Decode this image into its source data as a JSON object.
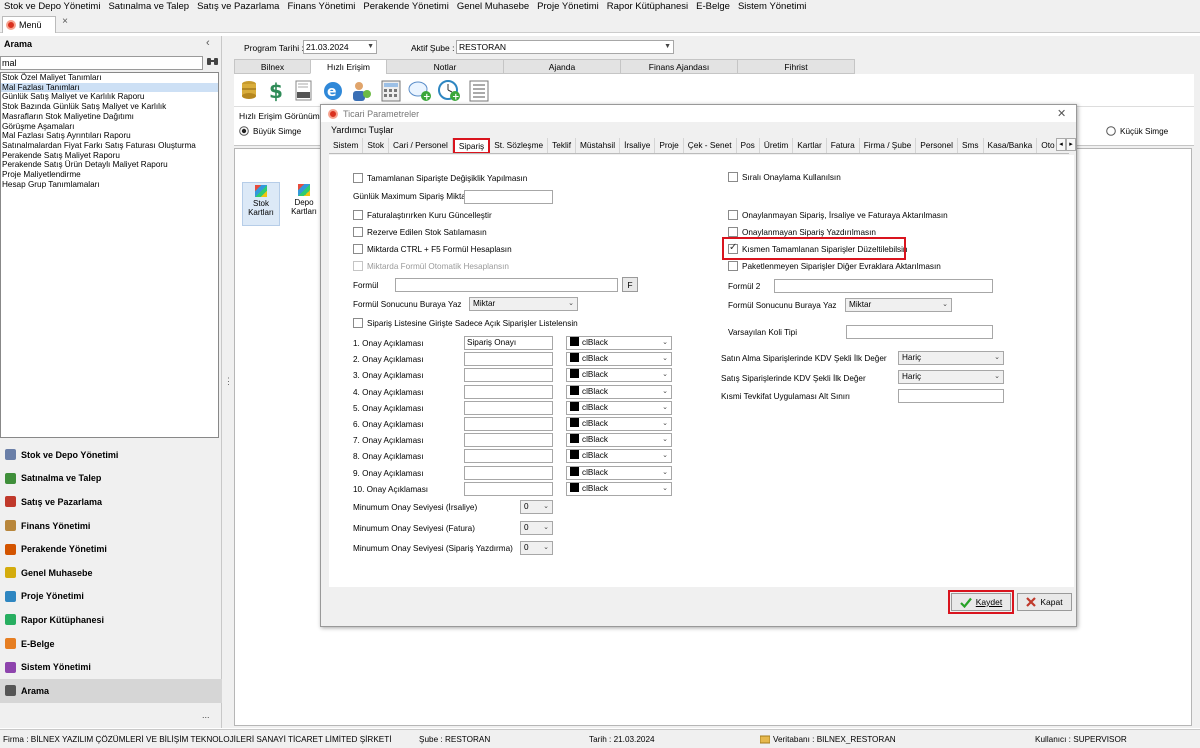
{
  "menubar": [
    "Stok ve Depo Yönetimi",
    "Satınalma ve Talep",
    "Satış ve Pazarlama",
    "Finans Yönetimi",
    "Perakende Yönetimi",
    "Genel Muhasebe",
    "Proje Yönetimi",
    "Rapor Kütüphanesi",
    "E-Belge",
    "Sistem Yönetimi"
  ],
  "doc_tab": {
    "label": "Menü",
    "close": "×"
  },
  "sidebar": {
    "title": "Arama",
    "collapse": "‹",
    "search_value": "mal",
    "results": [
      "Stok Özel Maliyet Tanımları",
      "Mal Fazlası Tanımları",
      "Günlük Satış Maliyet ve Karlılık Raporu",
      "Stok Bazında Günlük Satış Maliyet ve Karlılık",
      "Masrafların Stok Maliyetine Dağıtımı",
      "Görüşme Aşamaları",
      "Mal Fazlası Satış Ayrıntıları Raporu",
      "Satınalmalardan Fiyat Farkı Satış Faturası Oluşturma",
      "Perakende Satış Maliyet Raporu",
      "Perakende Satış Ürün Detaylı Maliyet Raporu",
      "Proje Maliyetlendirme",
      "Hesap Grup Tanımlamaları"
    ],
    "selected_index": 1,
    "nav": [
      {
        "label": "Stok ve Depo Yönetimi",
        "color": "#6a7fa8"
      },
      {
        "label": "Satınalma ve Talep",
        "color": "#3f8f3a"
      },
      {
        "label": "Satış ve Pazarlama",
        "color": "#c0392b"
      },
      {
        "label": "Finans Yönetimi",
        "color": "#b8863b"
      },
      {
        "label": "Perakende Yönetimi",
        "color": "#d35400"
      },
      {
        "label": "Genel Muhasebe",
        "color": "#d4ac0d"
      },
      {
        "label": "Proje Yönetimi",
        "color": "#2e86c1"
      },
      {
        "label": "Rapor Kütüphanesi",
        "color": "#27ae60"
      },
      {
        "label": "E-Belge",
        "color": "#e67e22"
      },
      {
        "label": "Sistem Yönetimi",
        "color": "#8e44ad"
      },
      {
        "label": "Arama",
        "color": "#555555"
      }
    ],
    "more": "..."
  },
  "top": {
    "program_date_label": "Program Tarihi :",
    "program_date": "21.03.2024",
    "active_branch_label": "Aktif Şube :",
    "active_branch": "RESTORAN"
  },
  "main_tabs": [
    "Bilnex",
    "Hızlı Erişim",
    "Notlar",
    "Ajanda",
    "Finans Ajandası",
    "Fihrist"
  ],
  "main_active_tab": 1,
  "view": {
    "title": "Hızlı Erişim Görünümü",
    "big": "Büyük Simge",
    "small": "Küçük Simge"
  },
  "tiles": [
    {
      "label": "Stok Kartları"
    },
    {
      "label": "Depo Kartları"
    }
  ],
  "dialog": {
    "title": "Ticari Parametreler",
    "subtitle": "Yardımcı Tuşlar",
    "close": "✕",
    "tabs": [
      "Sistem",
      "Stok",
      "Cari / Personel",
      "Sipariş",
      "St. Sözleşme",
      "Teklif",
      "Müstahsil",
      "İrsaliye",
      "Proje",
      "Çek - Senet",
      "Pos",
      "Üretim",
      "Kartlar",
      "Fatura",
      "Firma / Şube",
      "Personel",
      "Sms",
      "Kasa/Banka",
      "Oto Ser"
    ],
    "active_tab": 3,
    "left": {
      "cb_degisiklik": "Tamamlanan Siparişte Değişiklik Yapılmasın",
      "max_label": "Günlük Maximum Sipariş Miktarı",
      "max_value": "",
      "cb_kur": "Faturalaştırırken Kuru Güncelleştir",
      "cb_rezerve": "Rezerve Edilen Stok Satılamasın",
      "cb_ctrl": "Miktarda CTRL + F5 Formül Hesaplasın",
      "cb_formul_oto": "Miktarda Formül Otomatik Hesaplansın",
      "formul_label": "Formül",
      "formul_btn": "F",
      "formul_sonuc_label": "Formül Sonucunu Buraya Yaz",
      "formul_sonuc_value": "Miktar",
      "cb_acik": "Sipariş Listesine Girişte Sadece Açık Siparişler Listelensin",
      "approvals": [
        {
          "label": "1. Onay Açıklaması",
          "value": "Sipariş Onayı",
          "color": "clBlack"
        },
        {
          "label": "2. Onay Açıklaması",
          "value": "",
          "color": "clBlack"
        },
        {
          "label": "3. Onay Açıklaması",
          "value": "",
          "color": "clBlack"
        },
        {
          "label": "4. Onay Açıklaması",
          "value": "",
          "color": "clBlack"
        },
        {
          "label": "5. Onay Açıklaması",
          "value": "",
          "color": "clBlack"
        },
        {
          "label": "6. Onay Açıklaması",
          "value": "",
          "color": "clBlack"
        },
        {
          "label": "7. Onay Açıklaması",
          "value": "",
          "color": "clBlack"
        },
        {
          "label": "8. Onay Açıklaması",
          "value": "",
          "color": "clBlack"
        },
        {
          "label": "9. Onay Açıklaması",
          "value": "",
          "color": "clBlack"
        },
        {
          "label": "10. Onay Açıklaması",
          "value": "",
          "color": "clBlack"
        }
      ],
      "min_levels": [
        {
          "label": "Minumum Onay Seviyesi (İrsaliye)",
          "value": "0"
        },
        {
          "label": "Minumum Onay Seviyesi (Fatura)",
          "value": "0"
        },
        {
          "label": "Minumum Onay Seviyesi (Sipariş Yazdırma)",
          "value": "0"
        }
      ]
    },
    "right": {
      "cb_sirali": "Sıralı Onaylama Kullanılsın",
      "cb_onaylanmayan_aktar": "Onaylanmayan Sipariş, İrsaliye ve Faturaya Aktarılmasın",
      "cb_onaylanmayan_yazdir": "Onaylanmayan Sipariş Yazdırılmasın",
      "cb_kismen": "Kısmen Tamamlanan Siparişler Düzeltilebilsin",
      "cb_kismen_checked": true,
      "cb_paket": "Paketlenmeyen Siparişler Diğer Evraklara Aktarılmasın",
      "formul2_label": "Formül 2",
      "formul_sonuc_label": "Formül Sonucunu Buraya Yaz",
      "formul_sonuc_value": "Miktar",
      "koli_label": "Varsayılan Koli Tipi",
      "kdv_alma_label": "Satın Alma Siparişlerinde KDV Şekli İlk Değer",
      "kdv_alma_value": "Hariç",
      "kdv_satis_label": "Satış Siparişlerinde KDV Şekli İlk Değer",
      "kdv_satis_value": "Hariç",
      "tevkifat_label": "Kısmi Tevkifat Uygulaması Alt Sınırı"
    },
    "save": "Kaydet",
    "close_btn": "Kapat"
  },
  "status": {
    "firma": "Firma : BİLNEX YAZILIM ÇÖZÜMLERİ VE BİLİŞİM TEKNOLOJİLERİ SANAYİ TİCARET LİMİTED ŞİRKETİ",
    "sube": "Şube : RESTORAN",
    "tarih": "Tarih : 21.03.2024",
    "veritabani": "Veritabanı : BILNEX_RESTORAN",
    "kullanici": "Kullanıcı : SUPERVISOR"
  }
}
